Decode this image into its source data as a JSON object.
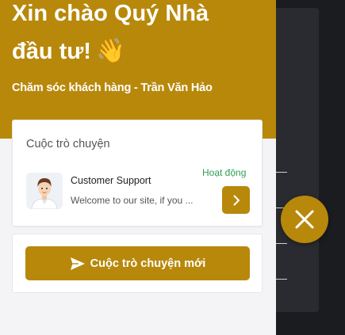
{
  "header": {
    "greeting_line1": "Xin chào Quý Nhà",
    "greeting_line2": "đầu tư!",
    "wave_emoji": "👋",
    "subtitle": "Chăm sóc khách hàng - Trần Văn Hảo"
  },
  "conversations": {
    "title": "Cuộc trò chuyện",
    "items": [
      {
        "agent_name": "Customer Support",
        "last_message": "Welcome to our site, if you ...",
        "status": "Hoạt động",
        "avatar_icon": "support-agent-avatar",
        "open_icon": "chevron-right-icon"
      }
    ]
  },
  "new_chat": {
    "label": "Cuộc trò chuyện mới",
    "icon": "send-icon"
  },
  "close_button": {
    "icon": "close-icon"
  },
  "colors": {
    "brand": "#b8880b",
    "status_online": "#2f9e55",
    "widget_bg": "#f4f4f6",
    "backdrop": "#1b1c20"
  }
}
